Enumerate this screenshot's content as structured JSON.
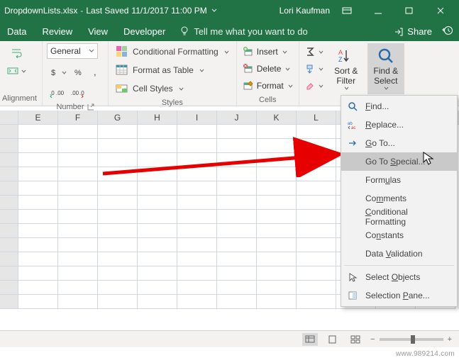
{
  "titlebar": {
    "filename": "DropdownLists.xlsx",
    "saved_prefix": "Last Saved ",
    "saved_time": "11/1/2017 11:00 PM",
    "user": "Lori Kaufman"
  },
  "tabs": {
    "data": "Data",
    "review": "Review",
    "view": "View",
    "developer": "Developer",
    "tellme": "Tell me what you want to do",
    "share": "Share"
  },
  "ribbon": {
    "alignment_label": "Alignment",
    "number_label": "Number",
    "number_format": "General",
    "styles_label": "Styles",
    "conditional_formatting": "Conditional Formatting",
    "format_as_table": "Format as Table",
    "cell_styles": "Cell Styles",
    "cells_label": "Cells",
    "insert": "Insert",
    "delete": "Delete",
    "format": "Format",
    "sort_filter": "Sort &\nFilter",
    "find_select": "Find &\nSelect"
  },
  "columns": [
    "E",
    "F",
    "G",
    "H",
    "I",
    "J",
    "K",
    "L"
  ],
  "menu": {
    "find": "Find...",
    "replace": "Replace...",
    "goto": "Go To...",
    "goto_special": "Go To Special...",
    "formulas": "Formulas",
    "comments": "Comments",
    "cond_fmt": "Conditional Formatting",
    "constants": "Constants",
    "data_validation": "Data Validation",
    "select_objects": "Select Objects",
    "selection_pane": "Selection Pane..."
  },
  "watermark": "www.989214.com"
}
